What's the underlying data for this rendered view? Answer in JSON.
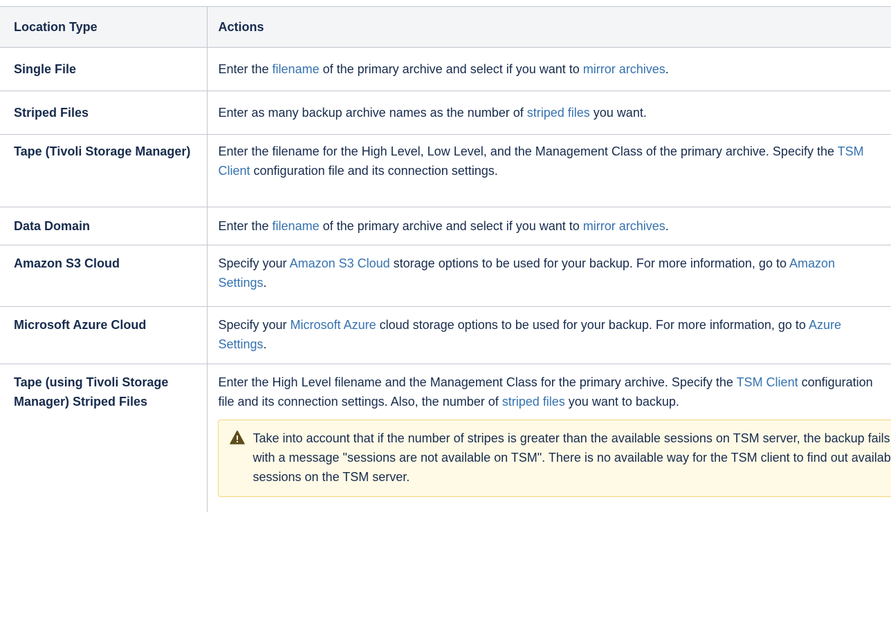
{
  "header": {
    "col1": "Location Type",
    "col2": "Actions"
  },
  "rows": [
    {
      "type": "Single File",
      "a1": "Enter the ",
      "l1": "filename",
      "a2": " of the primary archive and select if you want to ",
      "l2": "mirror archives",
      "a3": "."
    },
    {
      "type": "Striped Files",
      "a1": "Enter as many backup archive names as the number of ",
      "l1": "striped files",
      "a2": " you want."
    },
    {
      "type": "Tape (Tivoli Storage Manager)",
      "a1": "Enter the filename for the High Level, Low Level, and the Management Class of the primary archive. Specify the ",
      "l1": "TSM Client",
      "a2": " configuration file and its connection settings."
    },
    {
      "type": "Data Domain",
      "a1": "Enter the ",
      "l1": "filename",
      "a2": " of the primary archive and select if you want to ",
      "l2": "mirror archives",
      "a3": "."
    },
    {
      "type": "Amazon S3 Cloud",
      "a1": "Specify your ",
      "l1": "Amazon S3 Cloud",
      "a2": " storage options to be used for your backup. For more information, go to ",
      "l2": "Amazon Settings",
      "a3": "."
    },
    {
      "type": "Microsoft Azure Cloud",
      "a1": "Specify your ",
      "l1": "Microsoft Azure",
      "a2": " cloud storage options to be used for your backup. For more information, go to ",
      "l2": "Azure Settings",
      "a3": "."
    },
    {
      "type": "Tape (using Tivoli Storage Manager) Striped Files",
      "a1": "Enter the High Level filename and the Management Class for the primary archive. Specify the ",
      "l1": "TSM Client",
      "a2": " configuration file and its connection settings. Also, the number of ",
      "l2": "striped files",
      "a3": " you want to backup."
    }
  ],
  "warning": {
    "icon": "warning-icon",
    "text": "Take into account that if the number of stripes is greater than the available sessions on TSM server, the backup fails with a message \"sessions are not available on TSM\". There is no available way for the TSM client to find out available sessions on the TSM server."
  },
  "colors": {
    "link": "#3572b0",
    "header_bg": "#f4f5f7",
    "warning_bg": "#fffae6",
    "warning_border": "#f3d67a"
  }
}
